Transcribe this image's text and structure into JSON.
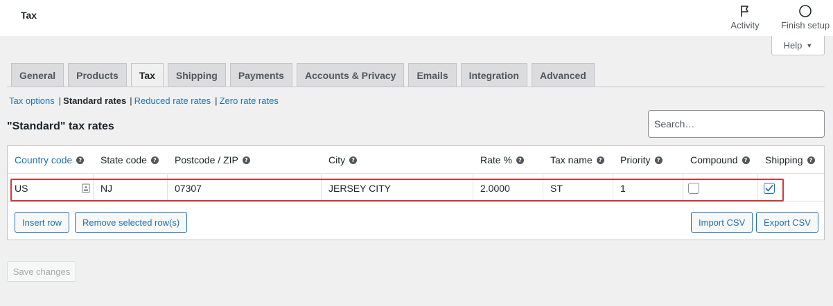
{
  "header": {
    "title": "Tax",
    "activity_label": "Activity",
    "finish_label": "Finish setup"
  },
  "help": {
    "label": "Help"
  },
  "tabs": [
    {
      "label": "General",
      "active": false
    },
    {
      "label": "Products",
      "active": false
    },
    {
      "label": "Tax",
      "active": true
    },
    {
      "label": "Shipping",
      "active": false
    },
    {
      "label": "Payments",
      "active": false
    },
    {
      "label": "Accounts & Privacy",
      "active": false
    },
    {
      "label": "Emails",
      "active": false
    },
    {
      "label": "Integration",
      "active": false
    },
    {
      "label": "Advanced",
      "active": false
    }
  ],
  "subnav": {
    "tax_options": "Tax options",
    "standard": "Standard rates",
    "reduced": "Reduced rate rates",
    "zero": "Zero rate rates",
    "separator": "|"
  },
  "section_title": "\"Standard\" tax rates",
  "search": {
    "placeholder": "Search…"
  },
  "table": {
    "columns": [
      "Country code",
      "State code",
      "Postcode / ZIP",
      "City",
      "Rate %",
      "Tax name",
      "Priority",
      "Compound",
      "Shipping"
    ],
    "row": {
      "country": "US",
      "state": "NJ",
      "postcode": "07307",
      "city": "JERSEY CITY",
      "rate": "2.0000",
      "tax_name": "ST",
      "priority": "1",
      "compound": false,
      "shipping": true
    }
  },
  "buttons": {
    "insert": "Insert row",
    "remove": "Remove selected row(s)",
    "import": "Import CSV",
    "export": "Export CSV",
    "save": "Save changes"
  },
  "colors": {
    "accent": "#2271b1",
    "highlight": "#d63638"
  }
}
